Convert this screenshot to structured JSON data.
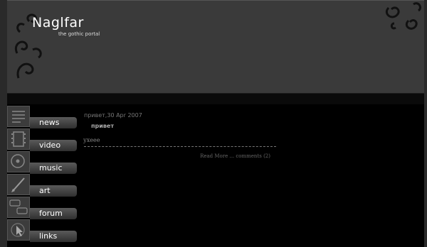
{
  "site": {
    "title": "Naglfar",
    "tagline": "the gothic portal"
  },
  "nav": [
    {
      "label": "news",
      "icon": "news-icon"
    },
    {
      "label": "video",
      "icon": "film-icon"
    },
    {
      "label": "music",
      "icon": "disc-icon"
    },
    {
      "label": "art",
      "icon": "pen-icon"
    },
    {
      "label": "forum",
      "icon": "speech-bubbles-icon"
    },
    {
      "label": "links",
      "icon": "cursor-icon"
    }
  ],
  "post": {
    "meta": "привет,30 Apr 2007",
    "title": "привет",
    "body": "ухеее",
    "footer": "Read More ... comments (2)"
  }
}
